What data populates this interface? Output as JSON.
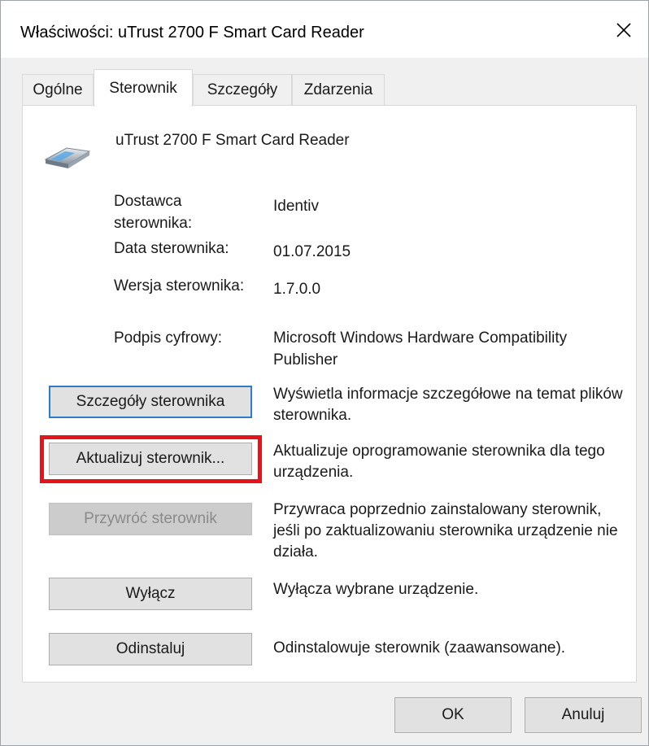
{
  "window": {
    "title": "Właściwości: uTrust 2700 F Smart Card Reader"
  },
  "tabs": [
    {
      "label": "Ogólne"
    },
    {
      "label": "Sterownik"
    },
    {
      "label": "Szczegóły"
    },
    {
      "label": "Zdarzenia"
    }
  ],
  "active_tab": "Sterownik",
  "device": {
    "icon": "smart-card-reader-icon",
    "name": "uTrust 2700 F Smart Card Reader"
  },
  "properties": [
    {
      "label": "Dostawca sterownika:",
      "value": "Identiv"
    },
    {
      "label": "Data sterownika:",
      "value": "01.07.2015"
    },
    {
      "label": "Wersja sterownika:",
      "value": "1.7.0.0"
    },
    {
      "label": "Podpis cyfrowy:",
      "value": "Microsoft Windows Hardware Compatibility Publisher"
    }
  ],
  "actions": [
    {
      "label": "Szczegóły sterownika",
      "description": "Wyświetla informacje szczegółowe na temat plików sterownika."
    },
    {
      "label": "Aktualizuj sterownik...",
      "description": "Aktualizuje oprogramowanie sterownika dla tego urządzenia."
    },
    {
      "label": "Przywróć sterownik",
      "description": "Przywraca poprzednio zainstalowany sterownik, jeśli po zaktualizowaniu sterownika urządzenie nie działa."
    },
    {
      "label": "Wyłącz",
      "description": "Wyłącza wybrane urządzenie."
    },
    {
      "label": "Odinstaluj",
      "description": "Odinstalowuje sterownik (zaawansowane)."
    }
  ],
  "footer": {
    "ok_label": "OK",
    "cancel_label": "Anuluj"
  },
  "colors": {
    "highlight": "#e3151a",
    "focus_border": "#2e7bc9",
    "button_face": "#e1e1e1"
  }
}
